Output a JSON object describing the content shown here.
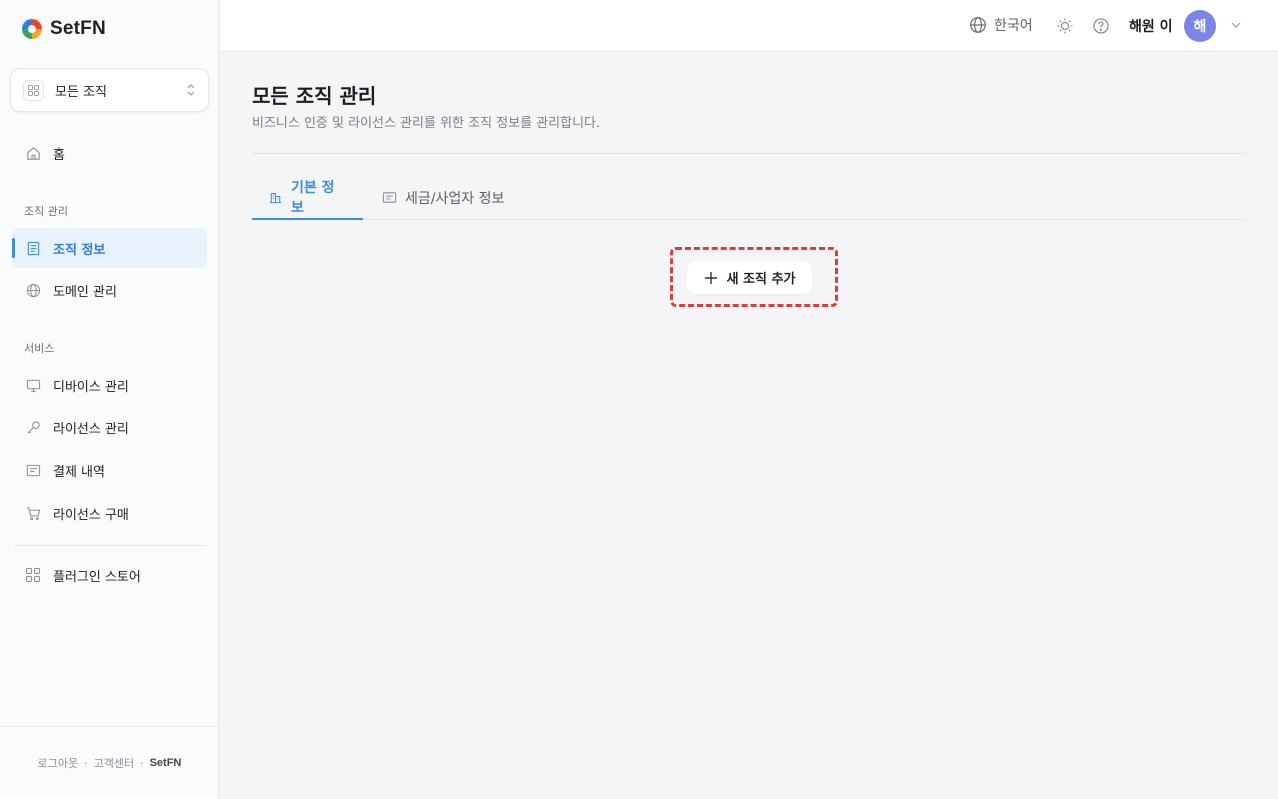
{
  "app": {
    "name": "SetFN"
  },
  "sidebar": {
    "org_selector": {
      "label": "모든 조직"
    },
    "home": {
      "label": "홈"
    },
    "sections": [
      {
        "title": "조직 관리",
        "items": [
          {
            "label": "조직 정보",
            "icon": "document-icon",
            "active": true
          },
          {
            "label": "도메인 관리",
            "icon": "globe-icon"
          }
        ]
      },
      {
        "title": "서비스",
        "items": [
          {
            "label": "디바이스 관리",
            "icon": "monitor-icon"
          },
          {
            "label": "라이선스 관리",
            "icon": "key-icon"
          },
          {
            "label": "결제 내역",
            "icon": "receipt-icon"
          },
          {
            "label": "라이선스 구매",
            "icon": "cart-icon"
          }
        ]
      }
    ],
    "plugin_store": {
      "label": "플러그인 스토어"
    },
    "footer": {
      "logout": "로그아웃",
      "support": "고객센터",
      "brand": "SetFN",
      "separator": "·"
    }
  },
  "header": {
    "language": "한국어",
    "user_name": "해원 이",
    "avatar_initial": "해"
  },
  "main": {
    "title": "모든 조직 관리",
    "subtitle": "비즈니스 인증 및 라이선스 관리를 위한 조직 정보를 관리합니다.",
    "tabs": [
      {
        "label": "기본 정보",
        "active": true
      },
      {
        "label": "세금/사업자 정보",
        "active": false
      }
    ],
    "add_button": {
      "label": "새 조직 추가"
    }
  },
  "colors": {
    "accent": "#3b8ede",
    "highlight": "#e03b3b",
    "avatar": "#7c86e6"
  }
}
